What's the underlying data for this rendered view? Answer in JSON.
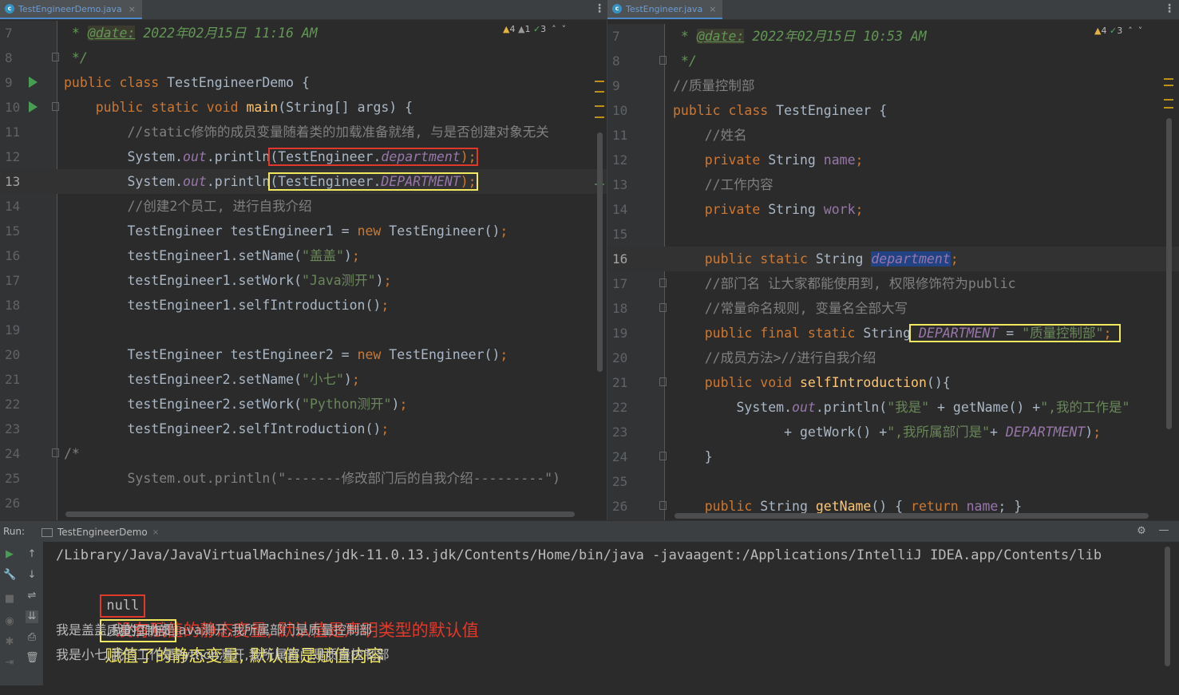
{
  "left": {
    "tab": {
      "icon_letter": "c",
      "name": "TestEngineerDemo.java",
      "close": "×"
    },
    "inspections": {
      "warn_icon": "▲",
      "warn": "4",
      "weak_icon": "▲",
      "weak": "1",
      "ok_icon": "✓",
      "ok": "3",
      "up": "˄",
      "down": "˅"
    },
    "lines": [
      {
        "n": "7"
      },
      {
        "n": "8"
      },
      {
        "n": "9"
      },
      {
        "n": "10"
      },
      {
        "n": "11"
      },
      {
        "n": "12"
      },
      {
        "n": "13"
      },
      {
        "n": "14"
      },
      {
        "n": "15"
      },
      {
        "n": "16"
      },
      {
        "n": "17"
      },
      {
        "n": "18"
      },
      {
        "n": "19"
      },
      {
        "n": "20"
      },
      {
        "n": "21"
      },
      {
        "n": "22"
      },
      {
        "n": "23"
      },
      {
        "n": "24"
      },
      {
        "n": "25"
      },
      {
        "n": "26"
      }
    ],
    "code": {
      "l7_star": " * ",
      "l7_tag": "@date:",
      "l7_rest": " 2022年02月15日 11:16 AM",
      "l8": " */",
      "l9_kw": "public class ",
      "l9_rest": "TestEngineerDemo {",
      "l10_kw": "    public static void ",
      "l10_fn": "main",
      "l10_rest": "(String[] args) {",
      "l11": "        //static修饰的成员变量随着类的加载准备就绪, 与是否创建对象无关",
      "l12_a": "        System.",
      "l12_out": "out",
      "l12_b": ".println",
      "l12_box_a": "(TestEngineer.",
      "l12_fld": "department",
      "l12_box_b": ");",
      "l13_a": "        System.",
      "l13_out": "out",
      "l13_b": ".println",
      "l13_box_a": "(TestEngineer.",
      "l13_fld": "DEPARTMENT",
      "l13_box_b": ");",
      "l14": "        //创建2个员工, 进行自我介绍",
      "l15_a": "        TestEngineer testEngineer1 = ",
      "l15_kw": "new",
      "l15_b": " TestEngineer()",
      "l15_semi": ";",
      "l16_a": "        testEngineer1.setName(",
      "l16_str": "\"盖盖\"",
      "l16_b": ")",
      "l16_semi": ";",
      "l17_a": "        testEngineer1.setWork(",
      "l17_str": "\"Java测开\"",
      "l17_b": ")",
      "l17_semi": ";",
      "l18_a": "        testEngineer1.selfIntroduction()",
      "l18_semi": ";",
      "l20_a": "        TestEngineer testEngineer2 = ",
      "l20_kw": "new",
      "l20_b": " TestEngineer()",
      "l20_semi": ";",
      "l21_a": "        testEngineer2.setName(",
      "l21_str": "\"小七\"",
      "l21_b": ")",
      "l21_semi": ";",
      "l22_a": "        testEngineer2.setWork(",
      "l22_str": "\"Python测开\"",
      "l22_b": ")",
      "l22_semi": ";",
      "l23_a": "        testEngineer2.selfIntroduction()",
      "l23_semi": ";",
      "l24": "/*",
      "l25": "        System.out.println(\"-------修改部门后的自我介绍---------\")"
    }
  },
  "right": {
    "tab": {
      "icon_letter": "c",
      "name": "TestEngineer.java",
      "close": "×"
    },
    "inspections": {
      "warn_icon": "▲",
      "warn": "4",
      "ok_icon": "✓",
      "ok": "3",
      "up": "˄",
      "down": "˅"
    },
    "lines": [
      {
        "n": "7"
      },
      {
        "n": "8"
      },
      {
        "n": "9"
      },
      {
        "n": "10"
      },
      {
        "n": "11"
      },
      {
        "n": "12"
      },
      {
        "n": "13"
      },
      {
        "n": "14"
      },
      {
        "n": "15"
      },
      {
        "n": "16"
      },
      {
        "n": "17"
      },
      {
        "n": "18"
      },
      {
        "n": "19"
      },
      {
        "n": "20"
      },
      {
        "n": "21"
      },
      {
        "n": "22"
      },
      {
        "n": "23"
      },
      {
        "n": "24"
      },
      {
        "n": "25"
      },
      {
        "n": "26"
      }
    ],
    "code": {
      "l7_star": " * ",
      "l7_tag": "@date:",
      "l7_rest": " 2022年02月15日 10:53 AM",
      "l8": " */",
      "l9": "//质量控制部",
      "l10_kw": "public class ",
      "l10_rest": "TestEngineer {",
      "l11": "    //姓名",
      "l12_kw": "    private ",
      "l12_a": "String ",
      "l12_fld": "name",
      "l12_semi": ";",
      "l13": "    //工作内容",
      "l14_kw": "    private ",
      "l14_a": "String ",
      "l14_fld": "work",
      "l14_semi": ";",
      "l16_kw": "    public static ",
      "l16_a": "String ",
      "l16_fld": "department",
      "l16_semi": ";",
      "l17": "    //部门名 让大家都能使用到, 权限修饰符为public",
      "l18": "    //常量命名规则, 变量名全部大写",
      "l19_kw": "    public final static ",
      "l19_a": "String",
      "l19_fld": " DEPARTMENT",
      "l19_eq": " = ",
      "l19_str": "\"质量控制部\"",
      "l19_semi": ";",
      "l20": "    //成员方法>//进行自我介绍",
      "l21_kw": "    public void ",
      "l21_fn": "selfIntroduction",
      "l21_rest": "(){",
      "l22_a": "        System.",
      "l22_out": "out",
      "l22_b": ".println(",
      "l22_s1": "\"我是\"",
      "l22_c": " + getName() +",
      "l22_s2": "\",我的工作是\"",
      "l23_a": "              + getWork() +",
      "l23_s": "\",我所属部门是\"",
      "l23_b": "+ ",
      "l23_fld": "DEPARTMENT",
      "l23_c": ")",
      "l23_semi": ";",
      "l24": "    }",
      "l26_kw": "    public ",
      "l26_a": "String ",
      "l26_fn": "getName",
      "l26_b": "() { ",
      "l26_kw2": "return ",
      "l26_fld": "name",
      "l26_c": "; }"
    }
  },
  "run": {
    "label": "Run:",
    "tab": "TestEngineerDemo",
    "tab_close": "×",
    "console": {
      "cmd": "/Library/Java/JavaVirtualMachines/jdk-11.0.13.jdk/Contents/Home/bin/java -javaagent:/Applications/IntelliJ IDEA.app/Contents/lib",
      "out1": "null",
      "note1": "没有赋值的静态变量, 默认值是声明类型的默认值",
      "out2": "质量控制部",
      "note2": "赋值了的静态变量, 默认值是赋值内容",
      "out3": "我是盖盖,我的工作是Java测开,我所属部门是质量控制部",
      "out4": "我是小七,我的工作是Python测开,我所属部门是质量控制部"
    },
    "tools": {
      "run": "▶",
      "up": "↑",
      "wrench": "🔧",
      "down": "↓",
      "stop": "■",
      "wrap": "⇌",
      "camera": "◉",
      "scroll": "⇊",
      "bug": "✱",
      "print": "⎙",
      "exit": "⇥",
      "trash": "🗑",
      "gear": "⚙",
      "minimize": "—"
    }
  },
  "colors": {
    "keyword": "#cc7832",
    "comment": "#808080",
    "string": "#6a8759",
    "field": "#9876aa",
    "method": "#ffc66d",
    "annotation_red": "#e0392b",
    "annotation_yellow": "#f2e85e"
  }
}
